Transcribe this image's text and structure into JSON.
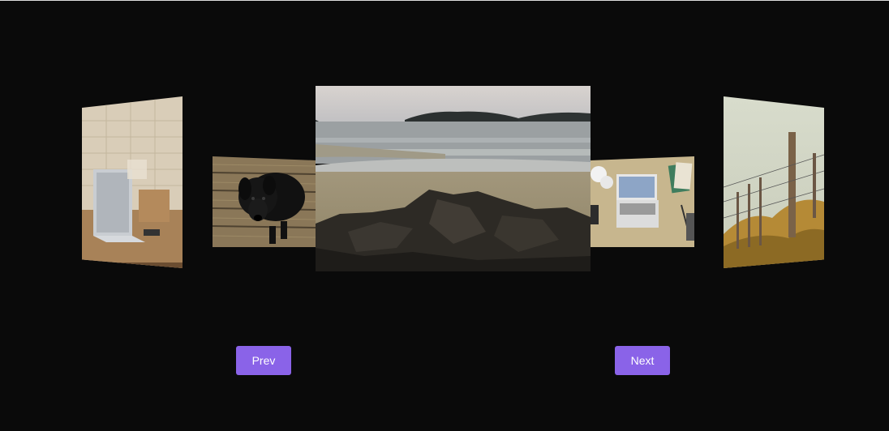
{
  "controls": {
    "prev_label": "Prev",
    "next_label": "Next"
  },
  "colors": {
    "background": "#0a0a0a",
    "button": "#8a63e8",
    "button_text": "#ffffff"
  },
  "slides": [
    {
      "subject": "laptop-on-wooden-table"
    },
    {
      "subject": "black-dog-on-wooden-deck"
    },
    {
      "subject": "beach-with-rocks-and-islands",
      "active": true
    },
    {
      "subject": "laptop-on-desk-top-view"
    },
    {
      "subject": "fence-post-in-golden-grass"
    }
  ]
}
